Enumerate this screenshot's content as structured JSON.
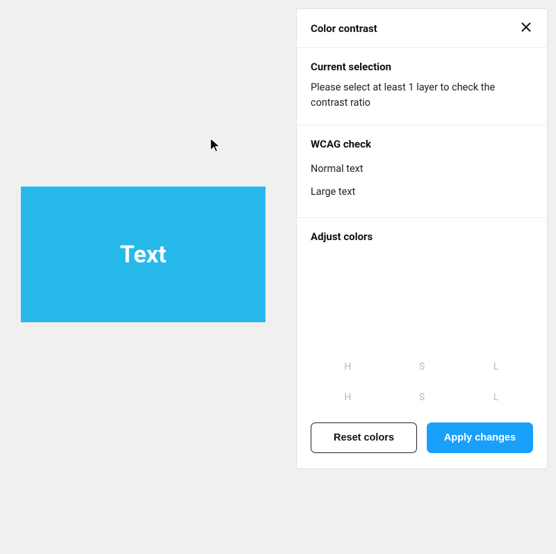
{
  "canvas": {
    "rect_text": "Text",
    "rect_bg": "#26b9ea",
    "rect_fg": "#ffffff"
  },
  "panel": {
    "title": "Color contrast",
    "selection": {
      "heading": "Current selection",
      "message": "Please select at least 1 layer to check the contrast ratio"
    },
    "wcag": {
      "heading": "WCAG check",
      "normal_label": "Normal text",
      "large_label": "Large text"
    },
    "adjust": {
      "heading": "Adjust colors",
      "hsl_labels": [
        "H",
        "S",
        "L"
      ],
      "reset_label": "Reset colors",
      "apply_label": "Apply changes"
    }
  },
  "colors": {
    "accent": "#18a0fb"
  }
}
